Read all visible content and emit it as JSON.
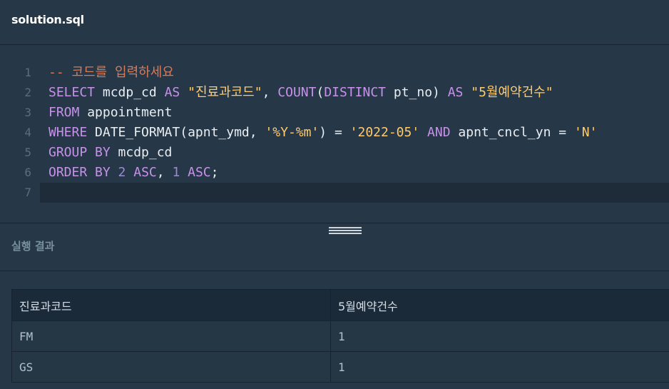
{
  "tab": {
    "title": "solution.sql"
  },
  "editor": {
    "lines": [
      {
        "no": "1",
        "tokens": [
          {
            "t": "-- 코드를 입력하세요",
            "c": "cmt"
          }
        ]
      },
      {
        "no": "2",
        "tokens": [
          {
            "t": "SELECT",
            "c": "kw"
          },
          {
            "t": " mcdp_cd ",
            "c": "plain"
          },
          {
            "t": "AS",
            "c": "kw"
          },
          {
            "t": " ",
            "c": "plain"
          },
          {
            "t": "\"진료과코드\"",
            "c": "str"
          },
          {
            "t": ", ",
            "c": "plain"
          },
          {
            "t": "COUNT",
            "c": "kw"
          },
          {
            "t": "(",
            "c": "plain"
          },
          {
            "t": "DISTINCT",
            "c": "kw"
          },
          {
            "t": " pt_no) ",
            "c": "plain"
          },
          {
            "t": "AS",
            "c": "kw"
          },
          {
            "t": " ",
            "c": "plain"
          },
          {
            "t": "\"5월예약건수\"",
            "c": "str"
          }
        ]
      },
      {
        "no": "3",
        "tokens": [
          {
            "t": "FROM",
            "c": "kw"
          },
          {
            "t": " appointment",
            "c": "plain"
          }
        ]
      },
      {
        "no": "4",
        "tokens": [
          {
            "t": "WHERE",
            "c": "kw"
          },
          {
            "t": " DATE_FORMAT(apnt_ymd, ",
            "c": "plain"
          },
          {
            "t": "'%Y-%m'",
            "c": "str"
          },
          {
            "t": ") = ",
            "c": "plain"
          },
          {
            "t": "'2022-05'",
            "c": "str"
          },
          {
            "t": " ",
            "c": "plain"
          },
          {
            "t": "AND",
            "c": "kw"
          },
          {
            "t": " apnt_cncl_yn = ",
            "c": "plain"
          },
          {
            "t": "'N'",
            "c": "str"
          }
        ]
      },
      {
        "no": "5",
        "tokens": [
          {
            "t": "GROUP BY",
            "c": "kw"
          },
          {
            "t": " mcdp_cd",
            "c": "plain"
          }
        ]
      },
      {
        "no": "6",
        "tokens": [
          {
            "t": "ORDER BY",
            "c": "kw"
          },
          {
            "t": " ",
            "c": "plain"
          },
          {
            "t": "2",
            "c": "num"
          },
          {
            "t": " ",
            "c": "plain"
          },
          {
            "t": "ASC",
            "c": "kw"
          },
          {
            "t": ", ",
            "c": "plain"
          },
          {
            "t": "1",
            "c": "num"
          },
          {
            "t": " ",
            "c": "plain"
          },
          {
            "t": "ASC",
            "c": "kw"
          },
          {
            "t": ";",
            "c": "plain"
          }
        ]
      },
      {
        "no": "7",
        "tokens": []
      }
    ],
    "active_line": "7"
  },
  "results": {
    "title": "실행 결과",
    "columns": [
      "진료과코드",
      "5월예약건수"
    ],
    "rows": [
      [
        "FM",
        "1"
      ],
      [
        "GS",
        "1"
      ]
    ]
  },
  "colors": {
    "background": "#263747",
    "keyword": "#c792ea",
    "string": "#ffcb6b",
    "comment": "#d87b5a"
  }
}
